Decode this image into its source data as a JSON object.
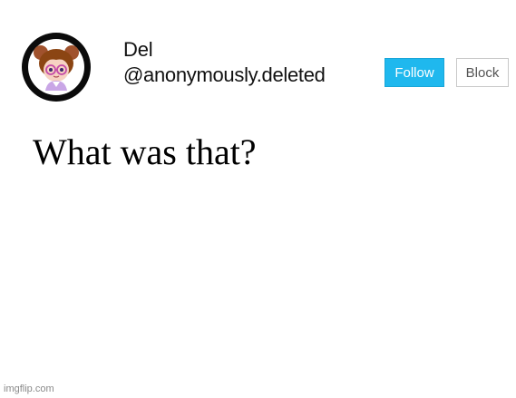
{
  "profile": {
    "display_name": "Del",
    "handle": "@anonymously.deleted",
    "avatar_icon": "avatar-chibi-girl-icon"
  },
  "actions": {
    "follow_label": "Follow",
    "block_label": "Block"
  },
  "post": {
    "text": "What was that?"
  },
  "watermark": {
    "text": "imgflip.com"
  },
  "colors": {
    "follow_button": "#1fb8ee",
    "block_border": "#c9c9c9",
    "background": "#ffffff"
  }
}
